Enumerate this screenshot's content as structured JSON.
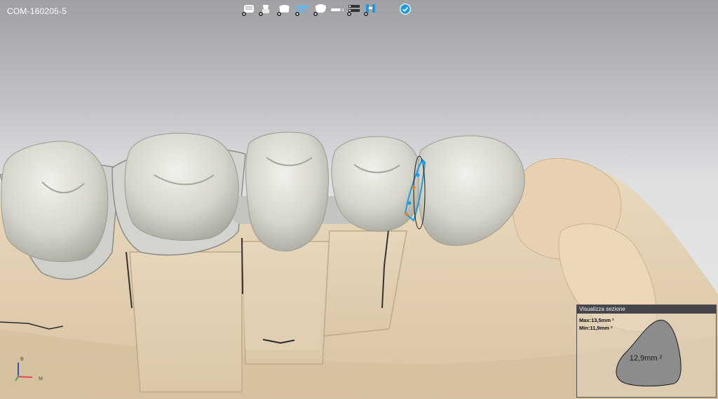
{
  "case": {
    "id": "COM-160205-5"
  },
  "toolbar": {
    "tools": [
      {
        "name": "full-arch-tool",
        "icon": "arch-icon"
      },
      {
        "name": "implant-tool",
        "icon": "implant-icon"
      },
      {
        "name": "coping-tool",
        "icon": "coping-icon"
      },
      {
        "name": "bridge-tool",
        "icon": "bridge-icon"
      },
      {
        "name": "crown-tool",
        "icon": "crown-icon"
      },
      {
        "name": "bar-tool",
        "icon": "bar-icon"
      },
      {
        "name": "layers-tool",
        "icon": "layers-icon"
      },
      {
        "name": "connector-tool",
        "icon": "connector-icon"
      }
    ],
    "active_tool": "connector-tool",
    "confirm_icon": "check-circle-icon"
  },
  "axis_gizmo": {
    "labels": {
      "up": "B",
      "right": "M"
    }
  },
  "section_panel": {
    "title": "Visualizza sezione",
    "max": "Max:13,5mm ²",
    "min": "Min:11,9mm ²",
    "value": "12,9mm ²"
  },
  "colors": {
    "accent": "#1e9be0",
    "gingiva": "#e4d3b6",
    "tooth": "#d9d8cf",
    "panel_header": "#46464a"
  }
}
